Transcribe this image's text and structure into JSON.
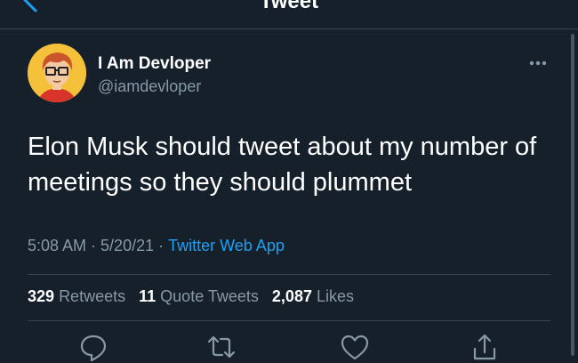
{
  "header": {
    "title": "Tweet",
    "back_icon": "chevron-left-icon"
  },
  "tweet": {
    "display_name": "I Am Devloper",
    "handle": "@iamdevloper",
    "text": "Elon Musk should tweet about my number of meetings so they should plummet",
    "time": "5:08 AM",
    "date": "5/20/21",
    "separator": "·",
    "source": "Twitter Web App",
    "more_icon": "more-horizontal-icon"
  },
  "stats": {
    "retweets_count": "329",
    "retweets_label": "Retweets",
    "quote_tweets_count": "11",
    "quote_tweets_label": "Quote Tweets",
    "likes_count": "2,087",
    "likes_label": "Likes"
  },
  "actions": [
    "reply-icon",
    "retweet-icon",
    "like-icon",
    "share-icon"
  ],
  "colors": {
    "background": "#15202b",
    "text": "#ffffff",
    "secondary_text": "#8899a6",
    "accent": "#1da1f2",
    "divider": "#38444d",
    "avatar_bg": "#f6c13a"
  }
}
